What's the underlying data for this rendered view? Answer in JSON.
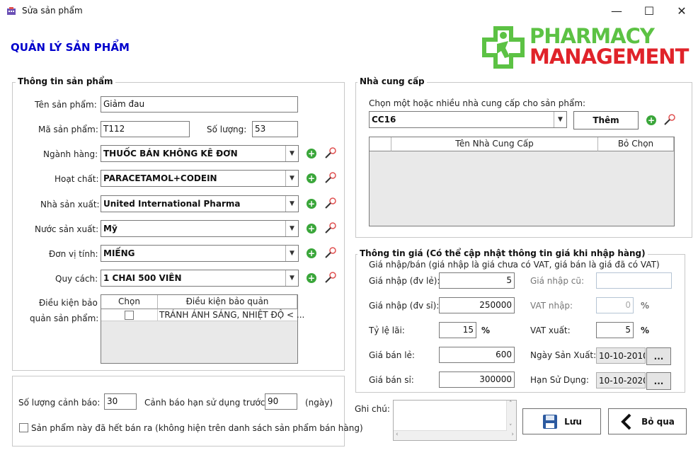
{
  "window": {
    "title": "Sửa sản phẩm",
    "minimize": "—",
    "maximize": "☐",
    "close": "✕"
  },
  "heading": "QUẢN LÝ SẢN PHẨM",
  "logo": {
    "line1": "PHARMACY",
    "line2": "MANAGEMENT"
  },
  "product_info": {
    "title": "Thông tin sản phẩm",
    "name_label": "Tên sản phẩm:",
    "name_value": "Giảm đau",
    "code_label": "Mã sản phẩm:",
    "code_value": "T112",
    "qty_label": "Số lượng:",
    "qty_value": "53",
    "category_label": "Ngành hàng:",
    "category_value": "THUỐC BÁN KHÔNG KÊ ĐƠN",
    "ingredient_label": "Hoạt chất:",
    "ingredient_value": "PARACETAMOL+CODEIN",
    "manufacturer_label": "Nhà sản xuất:",
    "manufacturer_value": "United International Pharma",
    "country_label": "Nước sản xuất:",
    "country_value": "Mỹ",
    "unit_label": "Đơn vị tính:",
    "unit_value": "MIẾNG",
    "packing_label": "Quy cách:",
    "packing_value": "1 CHAI 500 VIÊN",
    "storage_label_1": "Điều kiện bảo",
    "storage_label_2": "quản sản phẩm:",
    "storage_table": {
      "col_choose": "Chọn",
      "col_condition": "Điều kiện bảo quản",
      "rows": [
        {
          "checked": false,
          "condition": "TRÁNH ÁNH SÁNG, NHIỆT ĐỘ < ..."
        }
      ]
    }
  },
  "warning": {
    "qty_label": "Số lượng cảnh báo:",
    "qty_value": "30",
    "expiry_label": "Cảnh báo hạn sử dụng trước:",
    "expiry_value": "90",
    "unit": "(ngày)",
    "discontinued_label": "Sản phẩm này đã hết bán ra (không hiện trên danh sách sản phẩm bán hàng)"
  },
  "supplier": {
    "title": "Nhà cung cấp",
    "prompt": "Chọn một hoặc nhiều nhà cung cấp cho sản phẩm:",
    "selected": "CC16",
    "add_button": "Thêm",
    "col_name": "Tên Nhà Cung Cấp",
    "col_remove": "Bỏ Chọn"
  },
  "price": {
    "title": "Thông tin giá (Có thể cập nhật thông tin giá khi nhập hàng)",
    "note": "Giá nhập/bán (giá nhập là giá chưa có VAT, giá bán là giá đã có VAT)",
    "import_retail_label": "Giá nhập (đv lẻ):",
    "import_retail_value": "5",
    "import_wholesale_label": "Giá nhập (đv sỉ):",
    "import_wholesale_value": "250000",
    "profit_label": "Tỷ lệ lãi:",
    "profit_value": "15",
    "percent": "%",
    "sell_retail_label": "Giá bán lẻ:",
    "sell_retail_value": "600",
    "sell_wholesale_label": "Giá bán sỉ:",
    "sell_wholesale_value": "300000",
    "old_import_label": "Giá nhập cũ:",
    "old_import_value": "",
    "vat_in_label": "VAT nhập:",
    "vat_in_value": "0",
    "vat_out_label": "VAT xuất:",
    "vat_out_value": "5",
    "mfg_date_label": "Ngày Sản Xuất:",
    "mfg_date_value": "10-10-2010",
    "exp_date_label": "Hạn Sử Dụng:",
    "exp_date_value": "10-10-2020",
    "date_button": "..."
  },
  "note_label": "Ghi chú:",
  "save_button": "Lưu",
  "cancel_button": "Bỏ qua"
}
